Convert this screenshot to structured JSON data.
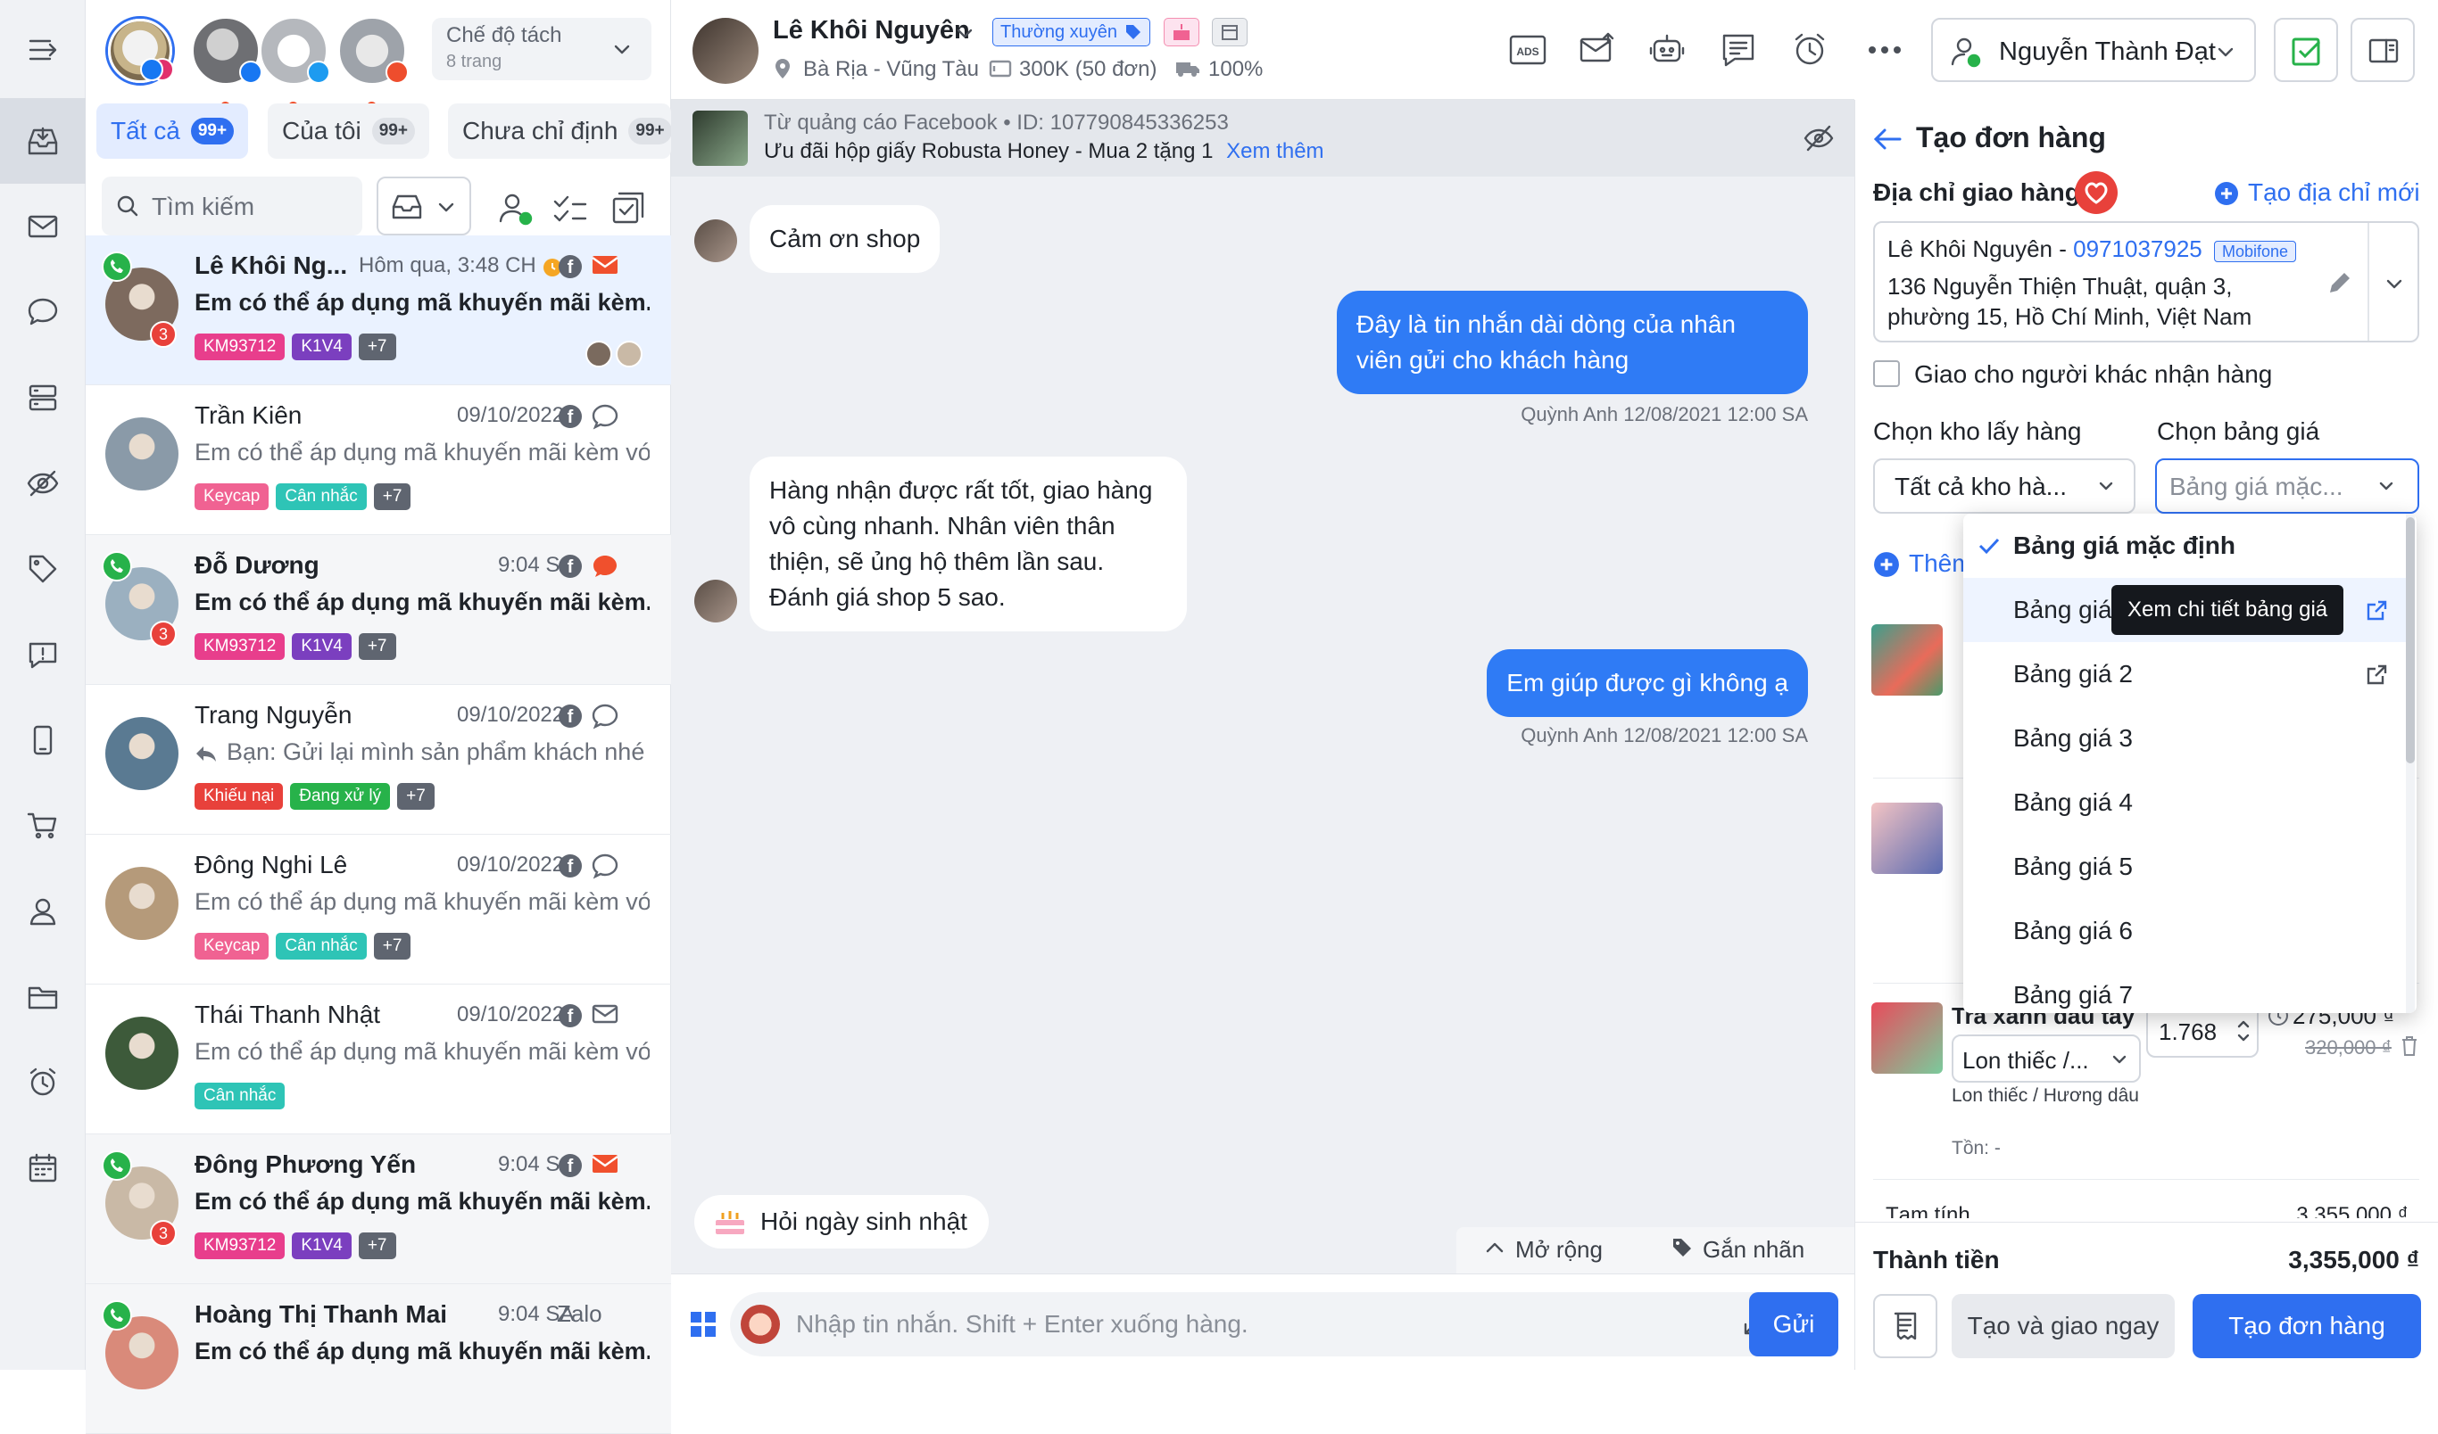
{
  "accounts": [
    {
      "name": "account-1",
      "color": "#e9a13b",
      "active": true,
      "has_dot": false
    },
    {
      "name": "account-2",
      "color": "#8c8f95",
      "active": false,
      "has_dot": true
    },
    {
      "name": "account-3",
      "color": "#b0b3b8",
      "active": false,
      "has_dot": true
    },
    {
      "name": "account-4",
      "color": "#9aa0a8",
      "active": false,
      "has_dot": true
    }
  ],
  "mode": {
    "title": "Chế độ tách",
    "sub": "8 trang"
  },
  "tabs": [
    {
      "label": "Tất cả",
      "count": "99+"
    },
    {
      "label": "Của tôi",
      "count": "99+"
    },
    {
      "label": "Chưa chỉ định",
      "count": "99+"
    }
  ],
  "search": {
    "placeholder": "Tìm kiếm"
  },
  "conversations": [
    {
      "name": "Lê Khôi Ng...",
      "time": "Hôm qua, 3:48 CH",
      "msg": "Em có thể áp dụng mã khuyến mãi kèm...",
      "tags": [
        {
          "t": "KM93712",
          "c": "#e83e8c"
        },
        {
          "t": "K1V4",
          "c": "#7b3fbf"
        },
        {
          "t": "+7",
          "c": "#5f6570"
        }
      ],
      "badge": "3",
      "phone": true,
      "state": "sel",
      "channel": "email",
      "av": "#7d6a5e"
    },
    {
      "name": "Trần Kiên",
      "time": "09/10/2022",
      "msg": "Em có thể áp dụng mã khuyến mãi kèm với...",
      "tags": [
        {
          "t": "Keycap",
          "c": "#f06292"
        },
        {
          "t": "Cân nhắc",
          "c": "#2ec4b6"
        },
        {
          "t": "+7",
          "c": "#5f6570"
        }
      ],
      "badge": "",
      "phone": false,
      "state": "",
      "channel": "chat",
      "av": "#8a9aa8"
    },
    {
      "name": "Đỗ Dương",
      "time": "9:04 SA",
      "msg": "Em có thể áp dụng mã khuyến mãi kèm...",
      "tags": [
        {
          "t": "KM93712",
          "c": "#e83e8c"
        },
        {
          "t": "K1V4",
          "c": "#7b3fbf"
        },
        {
          "t": "+7",
          "c": "#5f6570"
        }
      ],
      "badge": "3",
      "phone": true,
      "state": "unread",
      "channel": "chat-red",
      "av": "#9bb0c0"
    },
    {
      "name": "Trang Nguyễn",
      "time": "09/10/2022",
      "msg": "Bạn: Gửi lại mình sản phẩm khách nhé",
      "tags": [
        {
          "t": "Khiếu nại",
          "c": "#e8413b"
        },
        {
          "t": "Đang xử lý",
          "c": "#27b24a"
        },
        {
          "t": "+7",
          "c": "#5f6570"
        }
      ],
      "badge": "",
      "phone": false,
      "state": "",
      "channel": "chat",
      "av": "#5a7a92"
    },
    {
      "name": "Đông Nghi Lê",
      "time": "09/10/2022",
      "msg": "Em có thể áp dụng mã khuyến mãi kèm với...",
      "tags": [
        {
          "t": "Keycap",
          "c": "#f06292"
        },
        {
          "t": "Cân nhắc",
          "c": "#2ec4b6"
        },
        {
          "t": "+7",
          "c": "#5f6570"
        }
      ],
      "badge": "",
      "phone": false,
      "state": "",
      "channel": "chat",
      "av": "#b59a7a"
    },
    {
      "name": "Thái Thanh Nhật",
      "time": "09/10/2022",
      "msg": "Em có thể áp dụng mã khuyến mãi kèm với...",
      "tags": [
        {
          "t": "Cân nhắc",
          "c": "#2ec4b6"
        }
      ],
      "badge": "",
      "phone": false,
      "state": "",
      "channel": "email-gray",
      "av": "#3d5a3a"
    },
    {
      "name": "Đông Phương Yến",
      "time": "9:04 SA",
      "msg": "Em có thể áp dụng mã khuyến mãi kèm...",
      "tags": [
        {
          "t": "KM93712",
          "c": "#e83e8c"
        },
        {
          "t": "K1V4",
          "c": "#7b3fbf"
        },
        {
          "t": "+7",
          "c": "#5f6570"
        }
      ],
      "badge": "3",
      "phone": true,
      "state": "unread",
      "channel": "email",
      "av": "#c9b9a6"
    },
    {
      "name": "Hoàng Thị Thanh Mai",
      "time": "9:04 SA",
      "msg": "Em có thể áp dụng mã khuyến mãi kèm...",
      "tags": [],
      "badge": "",
      "phone": true,
      "state": "unread",
      "channel": "zalo",
      "av": "#d98a7a"
    }
  ],
  "chat": {
    "name": "Lê Khôi Nguyên",
    "tier": "Thường xuyên",
    "location": "Bà Rịa - Vũng Tàu",
    "spend": "300K (50 đơn)",
    "ship": "100%",
    "agent": "Nguyễn Thành Đạt",
    "ad_source": "Từ quảng cáo Facebook • ID: 107790845336253",
    "ad_title": "Ưu đãi hộp giấy Robusta Honey - Mua 2 tặng 1",
    "ad_more": "Xem thêm",
    "messages": [
      {
        "dir": "in",
        "text": "Cảm ơn shop"
      },
      {
        "dir": "out",
        "text": "Đây là tin nhắn dài dòng của nhân viên gửi cho khách hàng",
        "meta": "Quỳnh Anh 12/08/2021 12:00 SA"
      },
      {
        "dir": "in",
        "text": "Hàng nhận được rất tốt, giao hàng vô cùng nhanh. Nhân viên thân thiện, sẽ ủng hộ thêm lần sau. Đánh giá shop 5 sao."
      },
      {
        "dir": "out",
        "text": "Em giúp được gì không ạ",
        "meta": "Quỳnh Anh 12/08/2021 12:00 SA"
      }
    ],
    "birthday": "Hỏi ngày sinh nhật",
    "expand": "Mở rộng",
    "label": "Gắn nhãn",
    "input_placeholder": "Nhập tin nhắn. Shift + Enter xuống hàng.",
    "send": "Gửi"
  },
  "order": {
    "title": "Tạo đơn hàng",
    "address_label": "Địa chỉ giao hàng",
    "new_address": "Tạo địa chỉ mới",
    "cust_name": "Lê Khôi Nguyên -",
    "cust_phone": "0971037925",
    "carrier": "Mobifone",
    "address": "136 Nguyễn Thiện Thuật, quận 3, phường 15, Hồ Chí Minh, Việt Nam",
    "other_receiver": "Giao cho người khác nhận hàng",
    "warehouse_label": "Chọn kho lấy hàng",
    "pricelist_label": "Chọn bảng giá",
    "warehouse_value": "Tất cả kho hà...",
    "pricelist_value": "Bảng giá mặc...",
    "add_partial": "Thêm",
    "pricelists": [
      "Bảng giá mặc định",
      "Bảng giá",
      "Bảng giá 2",
      "Bảng giá 3",
      "Bảng giá 4",
      "Bảng giá 5",
      "Bảng giá 6",
      "Bảng giá 7"
    ],
    "tooltip": "Xem chi tiết bảng giá",
    "item_name": "Trà xanh dâu tây",
    "item_variant": "Lon thiếc /...",
    "item_variant_full": "Lon thiếc / Hương dâu",
    "item_stock": "Tồn: -",
    "item_qty": "1.768",
    "item_price": "275,000 ₫",
    "item_old_price": "320,000 ₫",
    "subtotal_partial": "Tạm tính",
    "subtotal_value": "3,355,000 ₫",
    "total_label": "Thành tiền",
    "total_value": "3,355,000 ₫",
    "btn_quick": "Tạo và giao ngay",
    "btn_create": "Tạo đơn hàng"
  },
  "colors": {
    "primary": "#2f6ff0",
    "danger": "#e8413b",
    "green": "#27b24a"
  }
}
